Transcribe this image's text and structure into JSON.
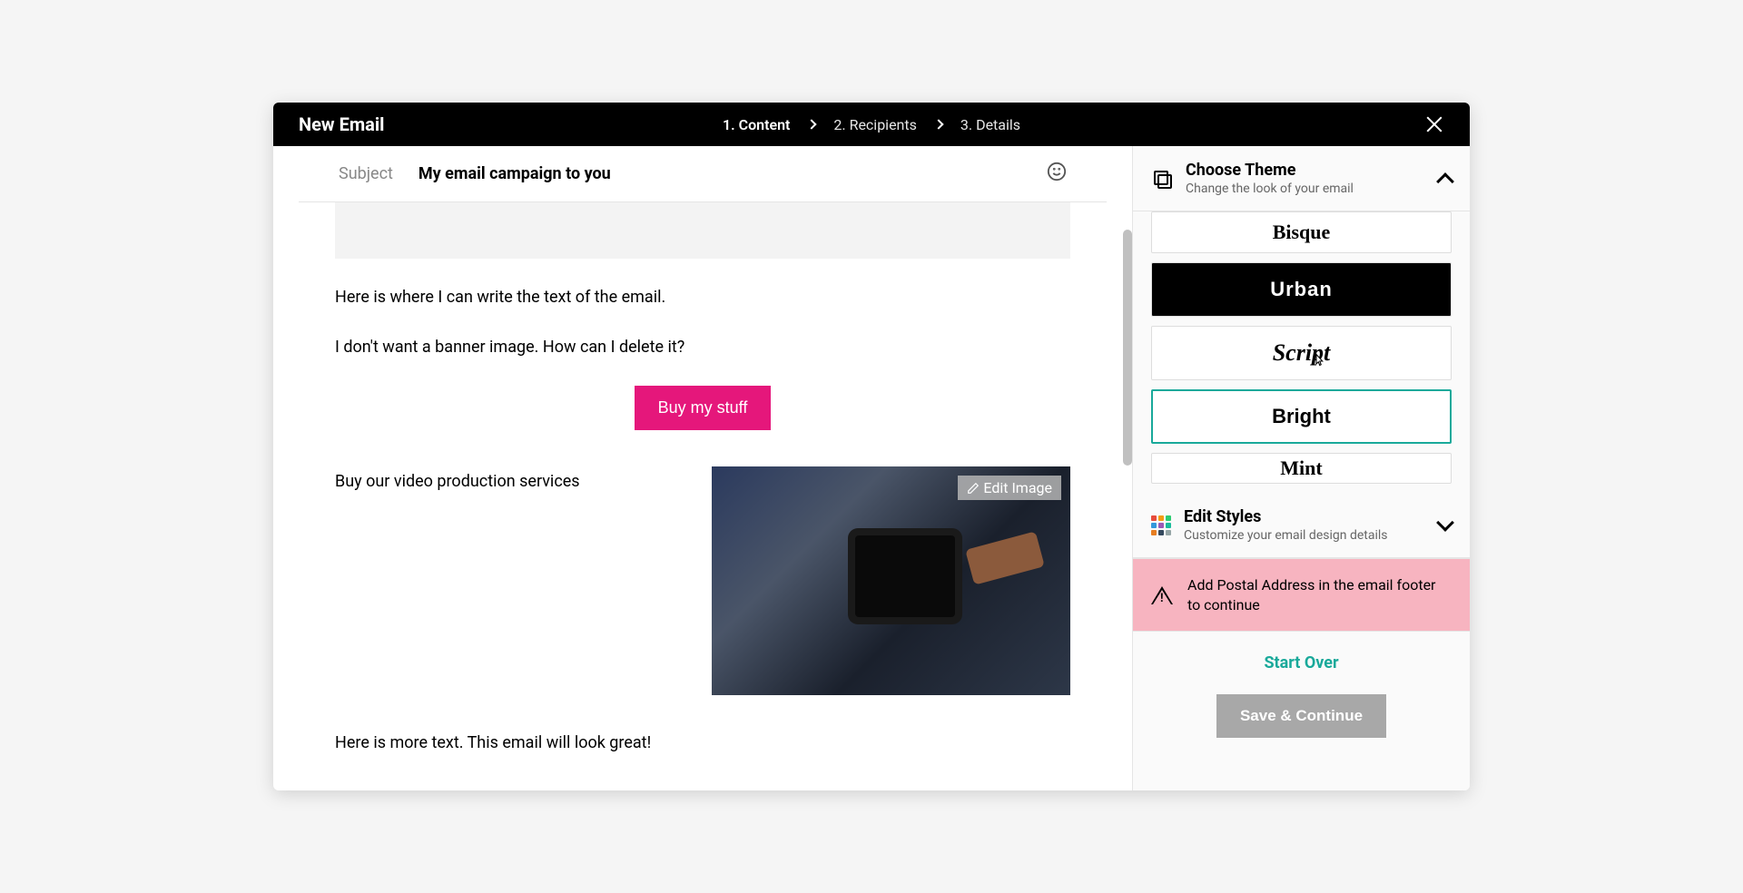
{
  "header": {
    "title": "New Email",
    "steps": [
      {
        "label": "1. Content",
        "active": true
      },
      {
        "label": "2. Recipients",
        "active": false
      },
      {
        "label": "3. Details",
        "active": false
      }
    ]
  },
  "subject": {
    "label": "Subject",
    "value": "My email campaign to you"
  },
  "editor": {
    "para1": "Here is where I can write the text of the email.",
    "para2": "I don't want a banner image. How can I delete it?",
    "cta": "Buy my stuff",
    "col_left": "Buy our video production services",
    "edit_image_label": "Edit Image",
    "para3": "Here is more text. This email will look great!"
  },
  "sidebar": {
    "choose_theme": {
      "title": "Choose Theme",
      "subtitle": "Change the look of your email",
      "expanded": true
    },
    "themes": [
      {
        "name": "Bisque",
        "class": "theme-bisque"
      },
      {
        "name": "Urban",
        "class": "theme-urban"
      },
      {
        "name": "Script",
        "class": "theme-script"
      },
      {
        "name": "Bright",
        "class": "theme-bright"
      },
      {
        "name": "Mint",
        "class": "theme-mint"
      }
    ],
    "edit_styles": {
      "title": "Edit Styles",
      "subtitle": "Customize your email design details",
      "expanded": false
    },
    "warning": "Add Postal Address in the email footer to continue",
    "start_over": "Start Over",
    "save_continue": "Save & Continue"
  },
  "colors": {
    "accent_pink": "#e5177b",
    "accent_teal": "#19a99a",
    "warning_bg": "#f7b4c0"
  }
}
